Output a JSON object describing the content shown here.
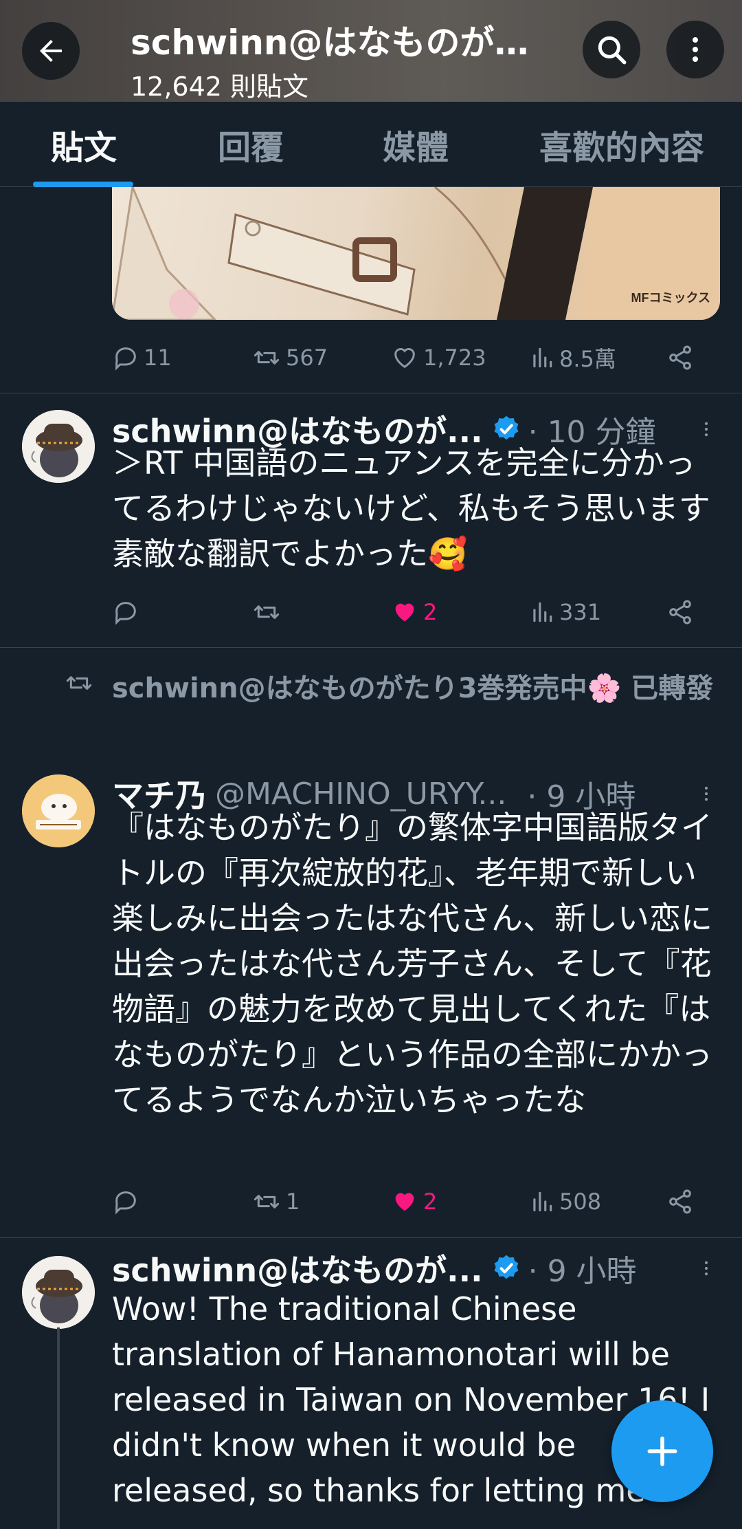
{
  "header": {
    "title": "schwinn@はなものがたり3巻発売中🌸",
    "post_count": "12,642 則貼文",
    "back_icon": "arrow-left-icon",
    "search_icon": "search-icon",
    "more_icon": "more-vertical-icon"
  },
  "tabs": [
    {
      "label": "貼文",
      "active": true
    },
    {
      "label": "回覆",
      "active": false
    },
    {
      "label": "媒體",
      "active": false
    },
    {
      "label": "喜歡的內容",
      "active": false
    }
  ],
  "media": {
    "label": "MFコミックス"
  },
  "tweet0": {
    "replies": "11",
    "retweets": "567",
    "likes": "1,723",
    "views": "8.5萬",
    "liked": false
  },
  "tweet1": {
    "name": "schwinn@はなものが...",
    "verified": true,
    "time": "· 10 分鐘",
    "text": "＞RT 中国語のニュアンスを完全に分かってるわけじゃないけど、私もそう思います　素敵な翻訳でよかった🥰",
    "replies": "",
    "retweets": "",
    "likes": "2",
    "views": "331",
    "liked": true
  },
  "retweet_banner": {
    "text": "schwinn@はなものがたり3巻発売中🌸 已轉發"
  },
  "tweet2": {
    "name": "マチ乃",
    "handle": "@MACHINO_URYY...",
    "time": "· 9 小時",
    "text": "『はなものがたり』の繁体字中国語版タイトルの『再次綻放的花』、老年期で新しい楽しみに出会ったはな代さん、新しい恋に出会ったはな代さん芳子さん、そして『花物語』の魅力を改めて見出してくれた『はなものがたり』という作品の全部にかかってるようでなんか泣いちゃったな",
    "replies": "",
    "retweets": "1",
    "likes": "2",
    "views": "508",
    "liked": true
  },
  "tweet3": {
    "name": "schwinn@はなものが...",
    "verified": true,
    "time": "· 9 小時",
    "text": "Wow! The traditional Chinese translation of Hanamonotari will be released in Taiwan on November 16! I didn't know when it would be released, so thanks for letting me"
  },
  "colors": {
    "background": "#15202b",
    "accent": "#1d9bf0",
    "like": "#f91880",
    "muted": "#8b98a5"
  },
  "fab": {
    "icon": "plus-icon"
  }
}
